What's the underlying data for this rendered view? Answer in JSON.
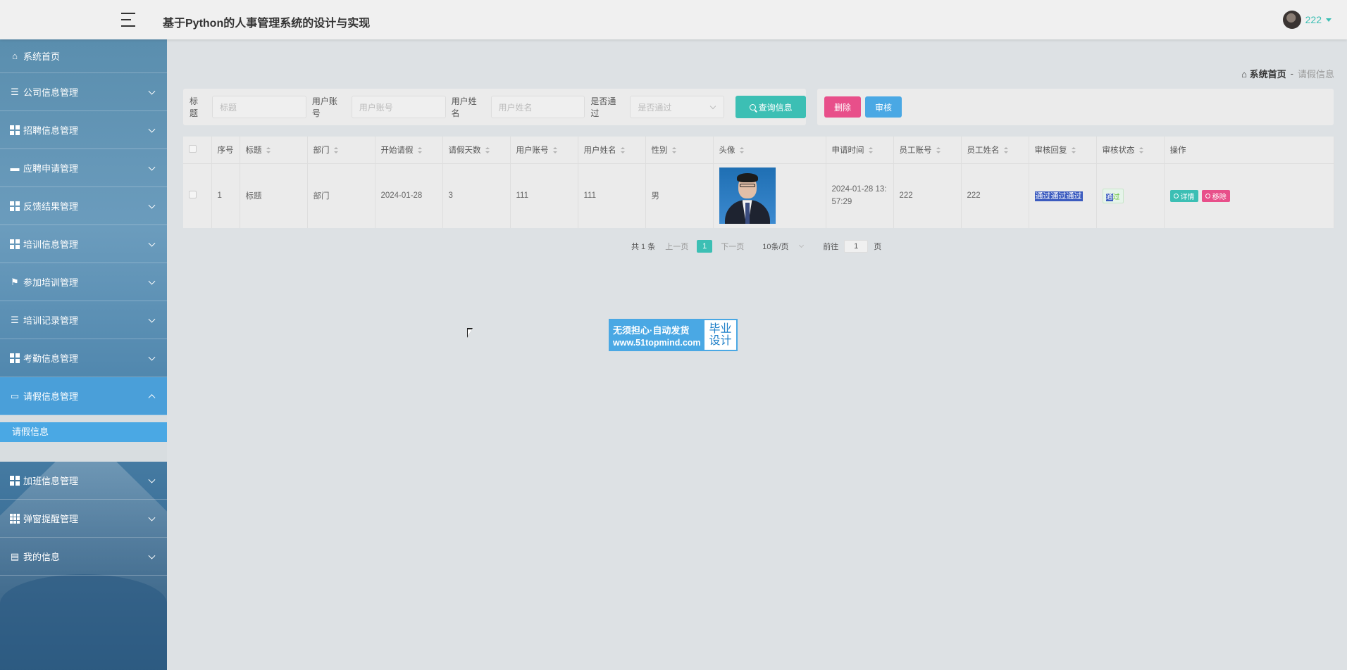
{
  "header": {
    "title": "基于Python的人事管理系统的设计与实现",
    "username": "222"
  },
  "sidebar": {
    "home": "系统首页",
    "items": [
      "公司信息管理",
      "招聘信息管理",
      "应聘申请管理",
      "反馈结果管理",
      "培训信息管理",
      "参加培训管理",
      "培训记录管理",
      "考勤信息管理",
      "请假信息管理"
    ],
    "sub_item": "请假信息",
    "items_after": [
      "加班信息管理",
      "弹窗提醒管理",
      "我的信息"
    ]
  },
  "breadcrumb": {
    "home": "系统首页",
    "sep": "-",
    "current": "请假信息"
  },
  "search": {
    "title_label": "标题",
    "title_placeholder": "标题",
    "account_label": "用户账号",
    "account_placeholder": "用户账号",
    "name_label": "用户姓名",
    "name_placeholder": "用户姓名",
    "pass_label": "是否通过",
    "pass_placeholder": "是否通过",
    "button": "查询信息"
  },
  "actions": {
    "delete": "删除",
    "audit": "审核"
  },
  "table": {
    "headers": [
      "序号",
      "标题",
      "部门",
      "开始请假",
      "请假天数",
      "用户账号",
      "用户姓名",
      "性别",
      "头像",
      "申请时间",
      "员工账号",
      "员工姓名",
      "审核回复",
      "审核状态",
      "操作"
    ],
    "row": {
      "index": "1",
      "title": "标题",
      "dept": "部门",
      "start": "2024-01-28",
      "days": "3",
      "account": "111",
      "name": "111",
      "gender": "男",
      "apply_time": "2024-01-28 13:57:29",
      "emp_account": "222",
      "emp_name": "222",
      "reply": "通过通过通过",
      "status_hl": "通",
      "status_rest": "过",
      "detail": "详情",
      "remove": "移除"
    }
  },
  "pagination": {
    "total": "共 1 条",
    "prev": "上一页",
    "page": "1",
    "next": "下一页",
    "size": "10条/页",
    "goto": "前往",
    "goto_page": "1",
    "page_unit": "页"
  },
  "watermark": {
    "line1": "无须担心·自动发货",
    "line2": "www.51topmind.com",
    "right1": "毕业",
    "right2": "设计"
  }
}
